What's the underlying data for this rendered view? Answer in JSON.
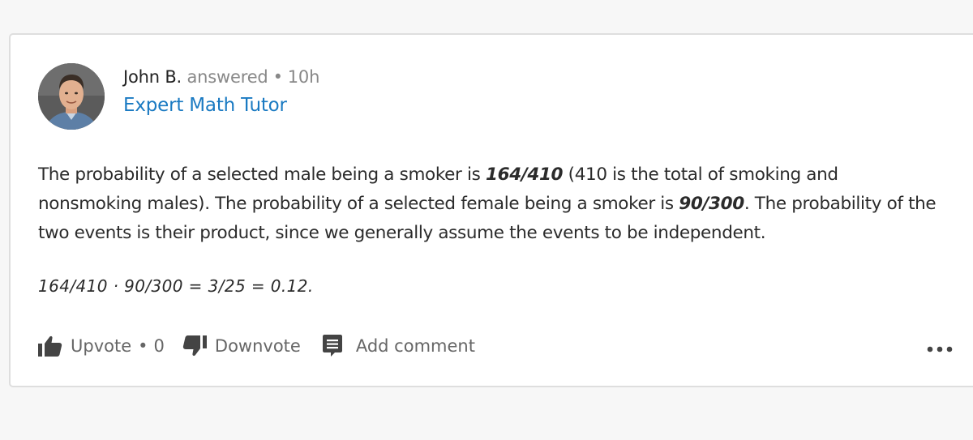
{
  "author": {
    "name": "John B.",
    "action": "answered",
    "separator": "•",
    "time": "10h",
    "role": "Expert Math Tutor"
  },
  "answer": {
    "p1_a": "The probability of a selected male being a smoker is ",
    "p1_b": "164/410",
    "p1_c": " (410 is the total of smoking and nonsmoking males). The probability of a selected female being a smoker is ",
    "p1_d": "90/300",
    "p1_e": ".  The probability of the two events is their product, since we generally assume the events to be independent.",
    "formula": "164/410  · 90/300 = 3/25 = 0.12."
  },
  "actions": {
    "upvote_label": "Upvote",
    "separator": "•",
    "upvote_count": "0",
    "downvote_label": "Downvote",
    "comment_label": "Add comment"
  },
  "icons": {
    "upvote": "thumbs-up-icon",
    "downvote": "thumbs-down-icon",
    "comment": "comment-icon",
    "more": "more-options-icon"
  },
  "colors": {
    "accent": "#1a7ac2",
    "icon": "#444444"
  }
}
